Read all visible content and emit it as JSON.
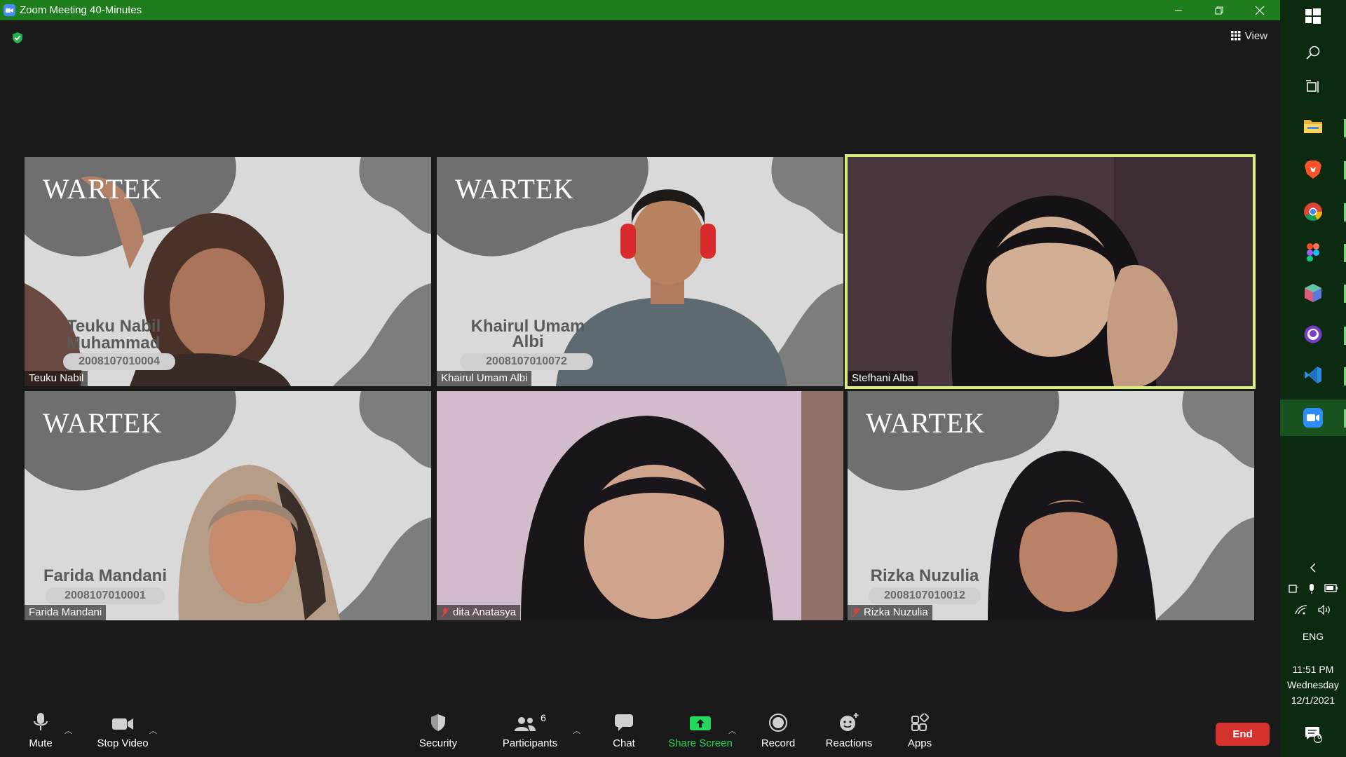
{
  "window": {
    "title": "Zoom Meeting 40-Minutes",
    "titlebar_color": "#1e7e1e",
    "controls": [
      "minimize-icon",
      "restore-icon",
      "close-icon"
    ]
  },
  "top": {
    "encryption_icon": "shield-check-icon",
    "view_label": "View"
  },
  "tiles": [
    {
      "display_name": "Teuku Nabil",
      "card_name": "Teuku Nabil Muhammad Dhu",
      "card_id": "2008107010004",
      "background": "wartek",
      "muted": false,
      "active": false
    },
    {
      "display_name": "Khairul Umam Albi",
      "card_name_1": "Khairul Umam",
      "card_name_2": "Albi",
      "card_id": "2008107010072",
      "background": "wartek",
      "muted": false,
      "active": false
    },
    {
      "display_name": "Stefhani Alba",
      "background": "camera",
      "muted": false,
      "active": true
    },
    {
      "display_name": "Farida Mandani",
      "card_name": "Farida Mandani",
      "card_id": "2008107010001",
      "background": "wartek",
      "muted": false,
      "active": false
    },
    {
      "display_name": "dita Anatasya",
      "background": "camera",
      "muted": true,
      "active": false
    },
    {
      "display_name": "Rizka Nuzulia",
      "card_name": "Rizka Nuzulia",
      "card_id": "2008107010012",
      "background": "wartek",
      "muted": true,
      "active": false
    }
  ],
  "brand_text": "WARTEK",
  "toolbar": {
    "mute": "Mute",
    "stop_video": "Stop Video",
    "security": "Security",
    "participants": "Participants",
    "participants_count": "6",
    "chat": "Chat",
    "share_screen": "Share Screen",
    "record": "Record",
    "reactions": "Reactions",
    "apps": "Apps",
    "end": "End",
    "share_color": "#23d959",
    "end_color": "#d5322d"
  },
  "taskbar": {
    "apps": [
      "windows-start-icon",
      "search-icon",
      "task-view-icon",
      "file-explorer-icon",
      "brave-browser-icon",
      "chrome-icon",
      "figma-icon",
      "app-cube-icon",
      "github-icon",
      "vscode-icon",
      "zoom-icon"
    ],
    "language": "ENG",
    "time": "11:51 PM",
    "day": "Wednesday",
    "date": "12/1/2021",
    "notifications_count": "6"
  }
}
